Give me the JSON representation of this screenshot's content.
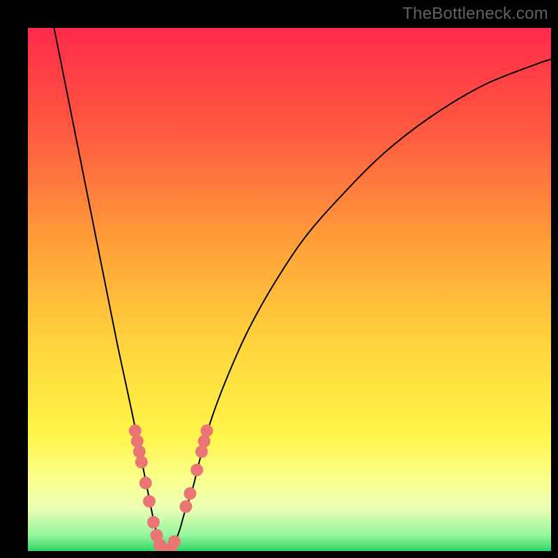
{
  "watermark": "TheBottleneck.com",
  "colors": {
    "black": "#000000",
    "curve": "#000000",
    "marker_fill": "#e97575",
    "marker_stroke": "#e97575"
  },
  "chart_data": {
    "type": "line",
    "title": "",
    "xlabel": "",
    "ylabel": "",
    "xlim": [
      0,
      100
    ],
    "ylim": [
      0,
      100
    ],
    "gradient_stops": [
      {
        "offset": 0.0,
        "color": "#ff2a4b"
      },
      {
        "offset": 0.2,
        "color": "#ff5a3f"
      },
      {
        "offset": 0.42,
        "color": "#ffa238"
      },
      {
        "offset": 0.62,
        "color": "#ffd83c"
      },
      {
        "offset": 0.78,
        "color": "#fff54a"
      },
      {
        "offset": 0.86,
        "color": "#fbff8b"
      },
      {
        "offset": 0.92,
        "color": "#e9ffb4"
      },
      {
        "offset": 0.97,
        "color": "#95f59b"
      },
      {
        "offset": 1.0,
        "color": "#2fd66a"
      }
    ],
    "series": [
      {
        "name": "bottleneck-curve",
        "x": [
          5,
          7,
          9,
          11,
          13,
          15,
          17,
          18.5,
          20,
          21,
          22,
          23,
          23.8,
          24.5,
          25.3,
          26,
          27,
          28,
          29,
          30,
          31.5,
          33,
          35,
          38,
          42,
          47,
          53,
          60,
          68,
          77,
          87,
          97,
          100
        ],
        "y": [
          100,
          90,
          80,
          70,
          60,
          50,
          40,
          33,
          26,
          21,
          16,
          11,
          7,
          4,
          2,
          0,
          0,
          1.5,
          4,
          7.5,
          12,
          18,
          25,
          33,
          42,
          51,
          60,
          68,
          76,
          83,
          89,
          93,
          94
        ]
      }
    ],
    "markers": [
      {
        "x": 20.5,
        "y": 23
      },
      {
        "x": 20.9,
        "y": 21
      },
      {
        "x": 21.3,
        "y": 19
      },
      {
        "x": 21.7,
        "y": 17
      },
      {
        "x": 22.5,
        "y": 13
      },
      {
        "x": 23.2,
        "y": 9.5
      },
      {
        "x": 24.0,
        "y": 5.5
      },
      {
        "x": 24.6,
        "y": 3.0
      },
      {
        "x": 25.2,
        "y": 1.2
      },
      {
        "x": 25.9,
        "y": 0.3
      },
      {
        "x": 26.6,
        "y": 0.1
      },
      {
        "x": 27.3,
        "y": 0.5
      },
      {
        "x": 28.0,
        "y": 1.8
      },
      {
        "x": 30.2,
        "y": 8.5
      },
      {
        "x": 31.0,
        "y": 11
      },
      {
        "x": 32.3,
        "y": 15.5
      },
      {
        "x": 33.2,
        "y": 19
      },
      {
        "x": 33.7,
        "y": 21
      },
      {
        "x": 34.2,
        "y": 23
      }
    ],
    "marker_radius_px": 8.5
  }
}
